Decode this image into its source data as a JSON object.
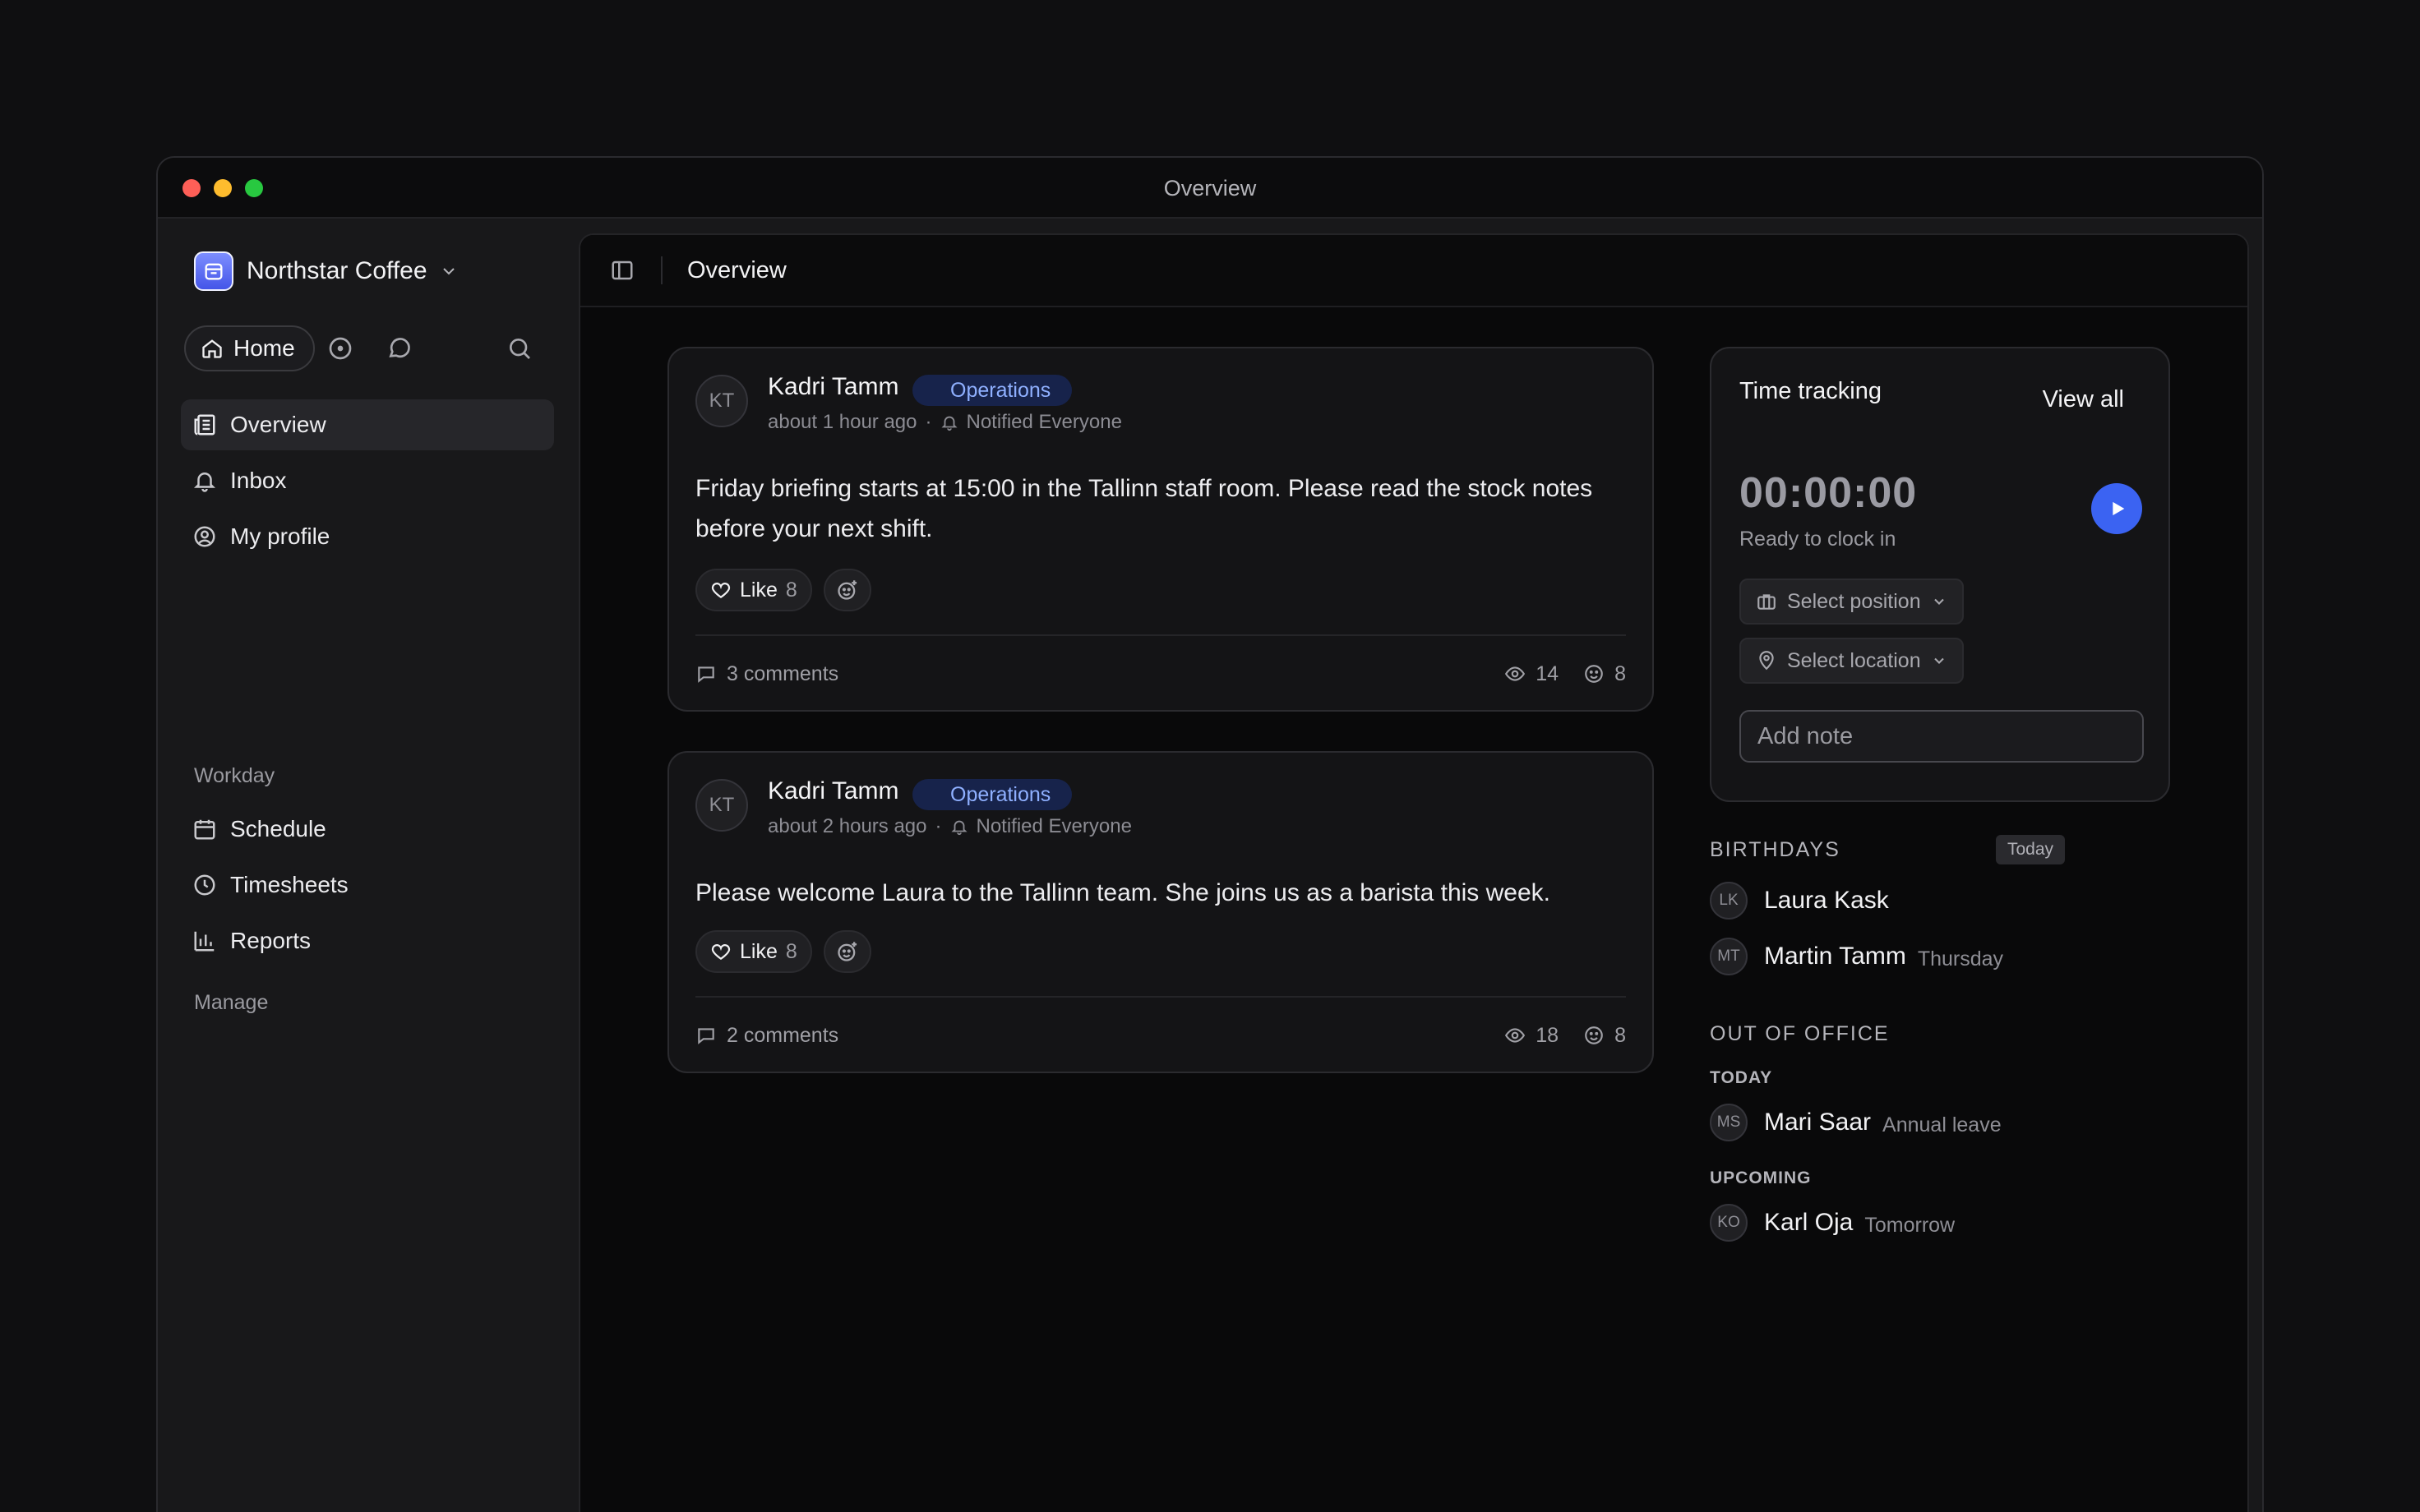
{
  "window": {
    "title": "Overview"
  },
  "sidebar": {
    "org_name": "Northstar Coffee",
    "home_label": "Home",
    "items": [
      {
        "label": "Overview",
        "icon": "newspaper-icon"
      },
      {
        "label": "Inbox",
        "icon": "bell-icon"
      },
      {
        "label": "My profile",
        "icon": "user-circle-icon"
      }
    ],
    "workday_label": "Workday",
    "workday_items": [
      {
        "label": "Schedule",
        "icon": "calendar-icon"
      },
      {
        "label": "Timesheets",
        "icon": "clock-icon"
      },
      {
        "label": "Reports",
        "icon": "bar-chart-icon"
      }
    ],
    "manage_label": "Manage"
  },
  "header": {
    "title": "Overview"
  },
  "posts": [
    {
      "avatar": "KT",
      "author": "Kadri Tamm",
      "tag": "Operations",
      "time": "about 1 hour ago",
      "notified": "Notified Everyone",
      "body": "Friday briefing starts at 15:00 in the Tallinn staff room. Please read the stock notes before your next shift.",
      "like_label": "Like",
      "like_count": "8",
      "comments": "3 comments",
      "views": "14",
      "reactions": "8"
    },
    {
      "avatar": "KT",
      "author": "Kadri Tamm",
      "tag": "Operations",
      "time": "about 2 hours ago",
      "notified": "Notified Everyone",
      "body": "Please welcome Laura to the Tallinn team. She joins us as a barista this week.",
      "like_label": "Like",
      "like_count": "8",
      "comments": "2 comments",
      "views": "18",
      "reactions": "8"
    }
  ],
  "time_tracking": {
    "title": "Time tracking",
    "view_all": "View all",
    "timer": "00:00:00",
    "status": "Ready to clock in",
    "position_select": "Select position",
    "location_select": "Select location",
    "note_placeholder": "Add note"
  },
  "birthdays": {
    "heading": "BIRTHDAYS",
    "badge": "Today",
    "people": [
      {
        "initials": "LK",
        "name": "Laura Kask",
        "note": ""
      },
      {
        "initials": "MT",
        "name": "Martin Tamm",
        "note": "Thursday"
      }
    ]
  },
  "out_of_office": {
    "heading": "OUT OF OFFICE",
    "today_label": "TODAY",
    "today": [
      {
        "initials": "MS",
        "name": "Mari Saar",
        "note": "Annual leave"
      }
    ],
    "upcoming_label": "UPCOMING",
    "upcoming": [
      {
        "initials": "KO",
        "name": "Karl Oja",
        "note": "Tomorrow"
      }
    ]
  },
  "colors": {
    "accent": "#3b63f2",
    "tag_bg": "#17234b",
    "tag_text": "#8fb0ff"
  }
}
